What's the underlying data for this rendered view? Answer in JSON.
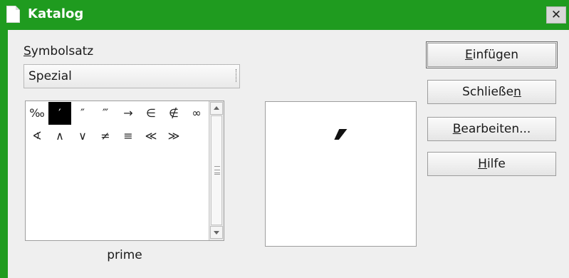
{
  "window": {
    "title": "Katalog",
    "close_label": "✕"
  },
  "symbol_set": {
    "label_mnemonic": "S",
    "label_rest": "ymbolsatz",
    "selected": "Spezial"
  },
  "symbols": [
    "‰",
    "′",
    "″",
    "‴",
    "→",
    "∈",
    "∉",
    "∞",
    "∢",
    "∧",
    "∨",
    "≠",
    "≡",
    "≪",
    "≫"
  ],
  "selected_index": 1,
  "selected_symbol_name": "prime",
  "preview_symbol": "′",
  "buttons": {
    "insert": {
      "mnemonic": "E",
      "rest": "infügen"
    },
    "close": {
      "prefix": "Schließe",
      "mnemonic": "n"
    },
    "edit": {
      "mnemonic": "B",
      "rest": "earbeiten..."
    },
    "help": {
      "mnemonic": "H",
      "rest": "ilfe"
    }
  },
  "colors": {
    "title_bar": "#1f9b1f",
    "dialog_bg": "#efefef",
    "selection": "#000000"
  }
}
